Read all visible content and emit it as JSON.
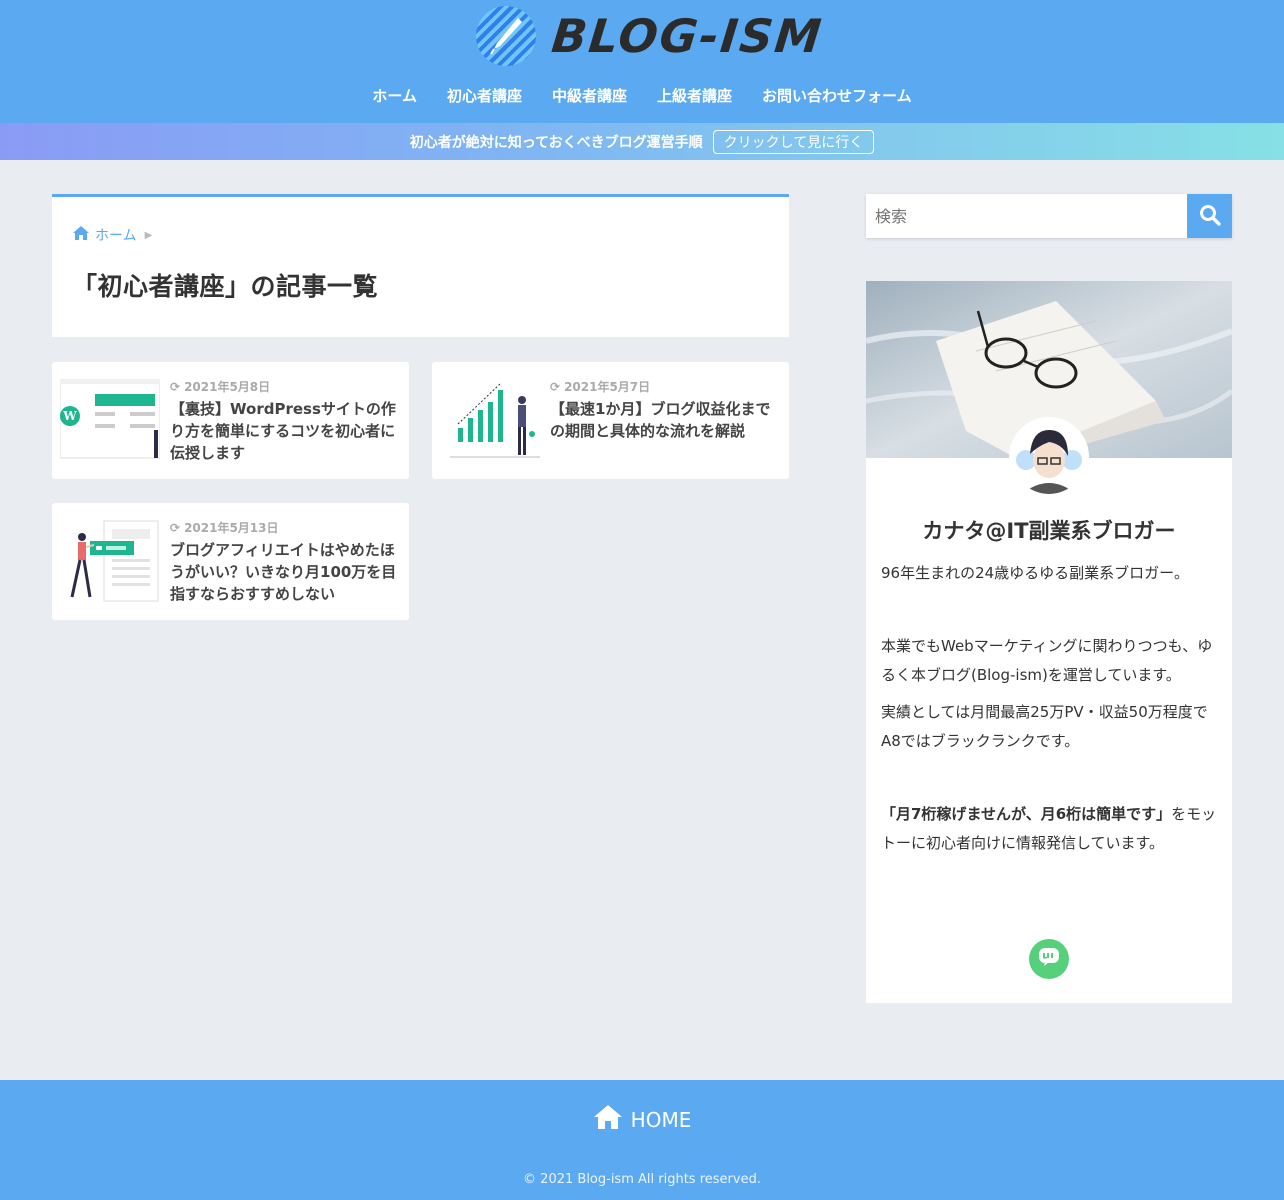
{
  "site": {
    "logo_text": "BLOG-ISM",
    "nav": [
      "ホーム",
      "初心者講座",
      "中級者講座",
      "上級者講座",
      "お問い合わせフォーム"
    ]
  },
  "notice": {
    "text": "初心者が絶対に知っておくべきブログ運営手順",
    "button": "クリックして見に行く"
  },
  "breadcrumb": {
    "home": "ホーム"
  },
  "page_title": "「初心者講座」の記事一覧",
  "cards": [
    {
      "date": "2021年5月8日",
      "title": "【裏技】WordPressサイトの作り方を簡単にするコツを初心者に伝授します"
    },
    {
      "date": "2021年5月7日",
      "title": "【最速1か月】ブログ収益化までの期間と具体的な流れを解説"
    },
    {
      "date": "2021年5月13日",
      "title": "ブログアフィリエイトはやめたほうがいい？いきなり月100万を目指すならおすすめしない"
    }
  ],
  "sidebar": {
    "search_placeholder": "検索",
    "profile_name": "カナタ@IT副業系ブロガー",
    "p1": "96年生まれの24歳ゆるゆる副業系ブロガー。",
    "p2": "本業でもWebマーケティングに関わりつつも、ゆるく本ブログ(Blog-ism)を運営しています。",
    "p3": "実績としては月間最高25万PV・収益50万程度でA8ではブラックランクです。",
    "p4_bold": "「月7桁稼げませんが、月6桁は簡単です」",
    "p4_rest": "をモットーに初心者向けに情報発信しています。"
  },
  "footer": {
    "home": "HOME",
    "copyright": "© 2021 Blog-ism All rights reserved."
  },
  "colors": {
    "primary": "#5ba9f0",
    "line_green": "#57d07c",
    "background": "#e9edf2"
  }
}
